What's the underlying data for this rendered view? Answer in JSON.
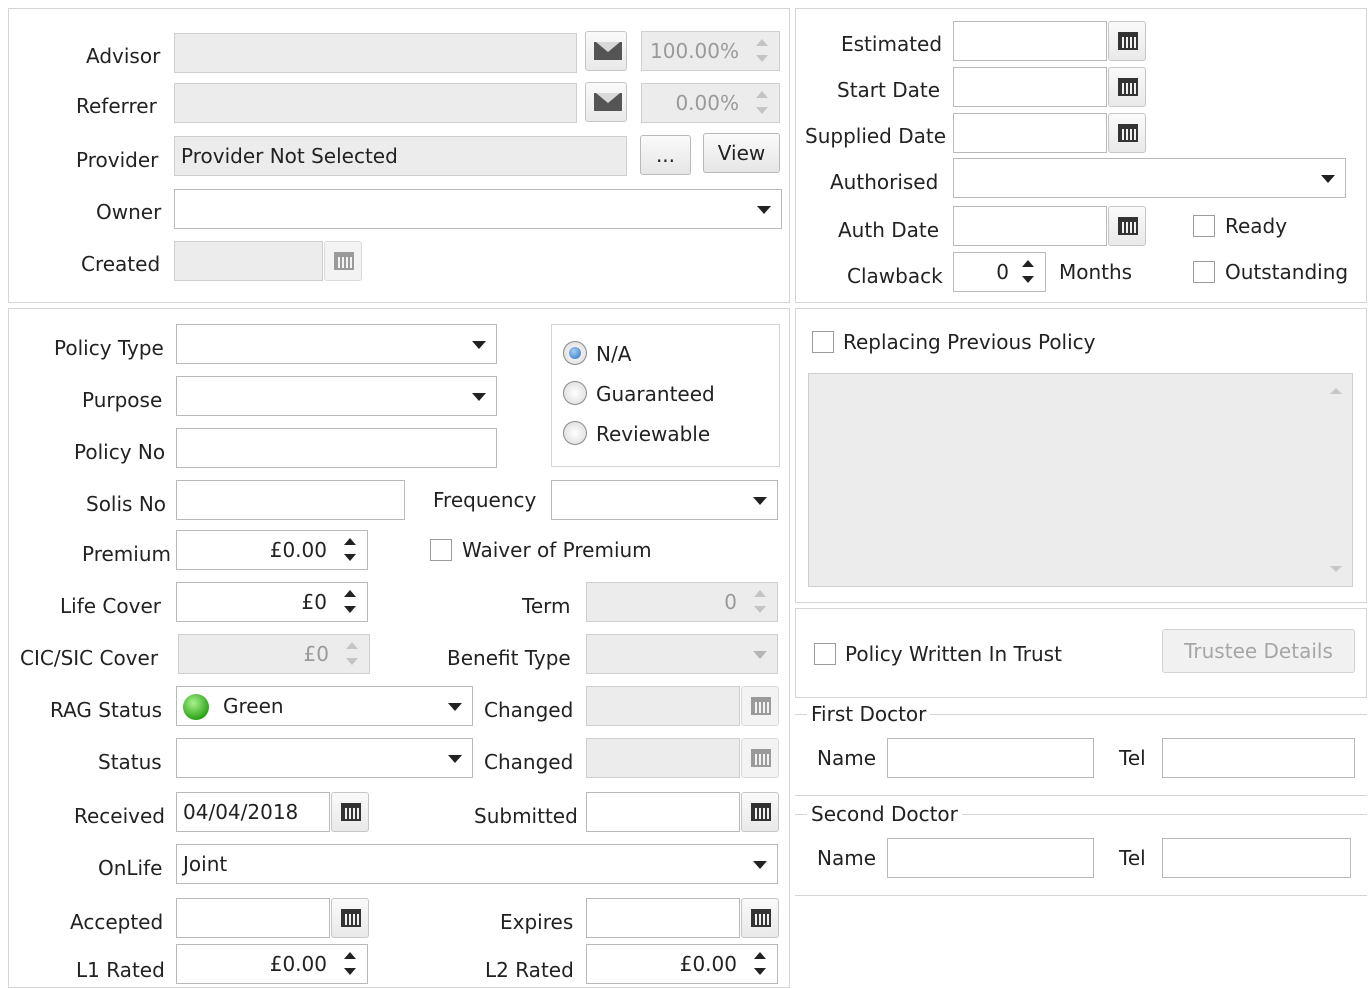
{
  "advisor": {
    "label": "Advisor",
    "value": "",
    "percent": "100.00%"
  },
  "referrer": {
    "label": "Referrer",
    "value": "",
    "percent": "0.00%"
  },
  "provider": {
    "label": "Provider",
    "value": "Provider Not Selected",
    "browse_label": "...",
    "view_label": "View"
  },
  "owner": {
    "label": "Owner",
    "value": ""
  },
  "created": {
    "label": "Created",
    "value": ""
  },
  "dates": {
    "estimated_label": "Estimated",
    "start_label": "Start Date",
    "supplied_label": "Supplied Date",
    "authorised_label": "Authorised",
    "auth_date_label": "Auth Date",
    "clawback_label": "Clawback",
    "clawback_value": "0",
    "months_label": "Months",
    "ready_label": "Ready",
    "outstanding_label": "Outstanding"
  },
  "policy": {
    "policy_type_label": "Policy Type",
    "purpose_label": "Purpose",
    "policy_no_label": "Policy No",
    "solis_no_label": "Solis No",
    "frequency_label": "Frequency",
    "premium_label": "Premium",
    "premium_value": "£0.00",
    "waiver_label": "Waiver of Premium",
    "life_cover_label": "Life Cover",
    "life_cover_value": "£0",
    "term_label": "Term",
    "term_value": "0",
    "cic_label": "CIC/SIC Cover",
    "cic_value": "£0",
    "benefit_type_label": "Benefit Type",
    "rag_label": "RAG Status",
    "rag_value": "Green",
    "changed_label": "Changed",
    "status_label": "Status",
    "received_label": "Received",
    "received_value": "04/04/2018",
    "submitted_label": "Submitted",
    "onlife_label": "OnLife",
    "onlife_value": "Joint",
    "accepted_label": "Accepted",
    "expires_label": "Expires",
    "l1_label": "L1 Rated",
    "l1_value": "£0.00",
    "l2_label": "L2 Rated",
    "l2_value": "£0.00"
  },
  "premium_basis": {
    "options": [
      "N/A",
      "Guaranteed",
      "Reviewable"
    ],
    "selected": "N/A"
  },
  "replacing": {
    "label": "Replacing Previous Policy"
  },
  "trust": {
    "label": "Policy Written In Trust",
    "trustee_button": "Trustee Details"
  },
  "first_doctor": {
    "title": "First Doctor",
    "name_label": "Name",
    "tel_label": "Tel"
  },
  "second_doctor": {
    "title": "Second Doctor",
    "name_label": "Name",
    "tel_label": "Tel"
  }
}
